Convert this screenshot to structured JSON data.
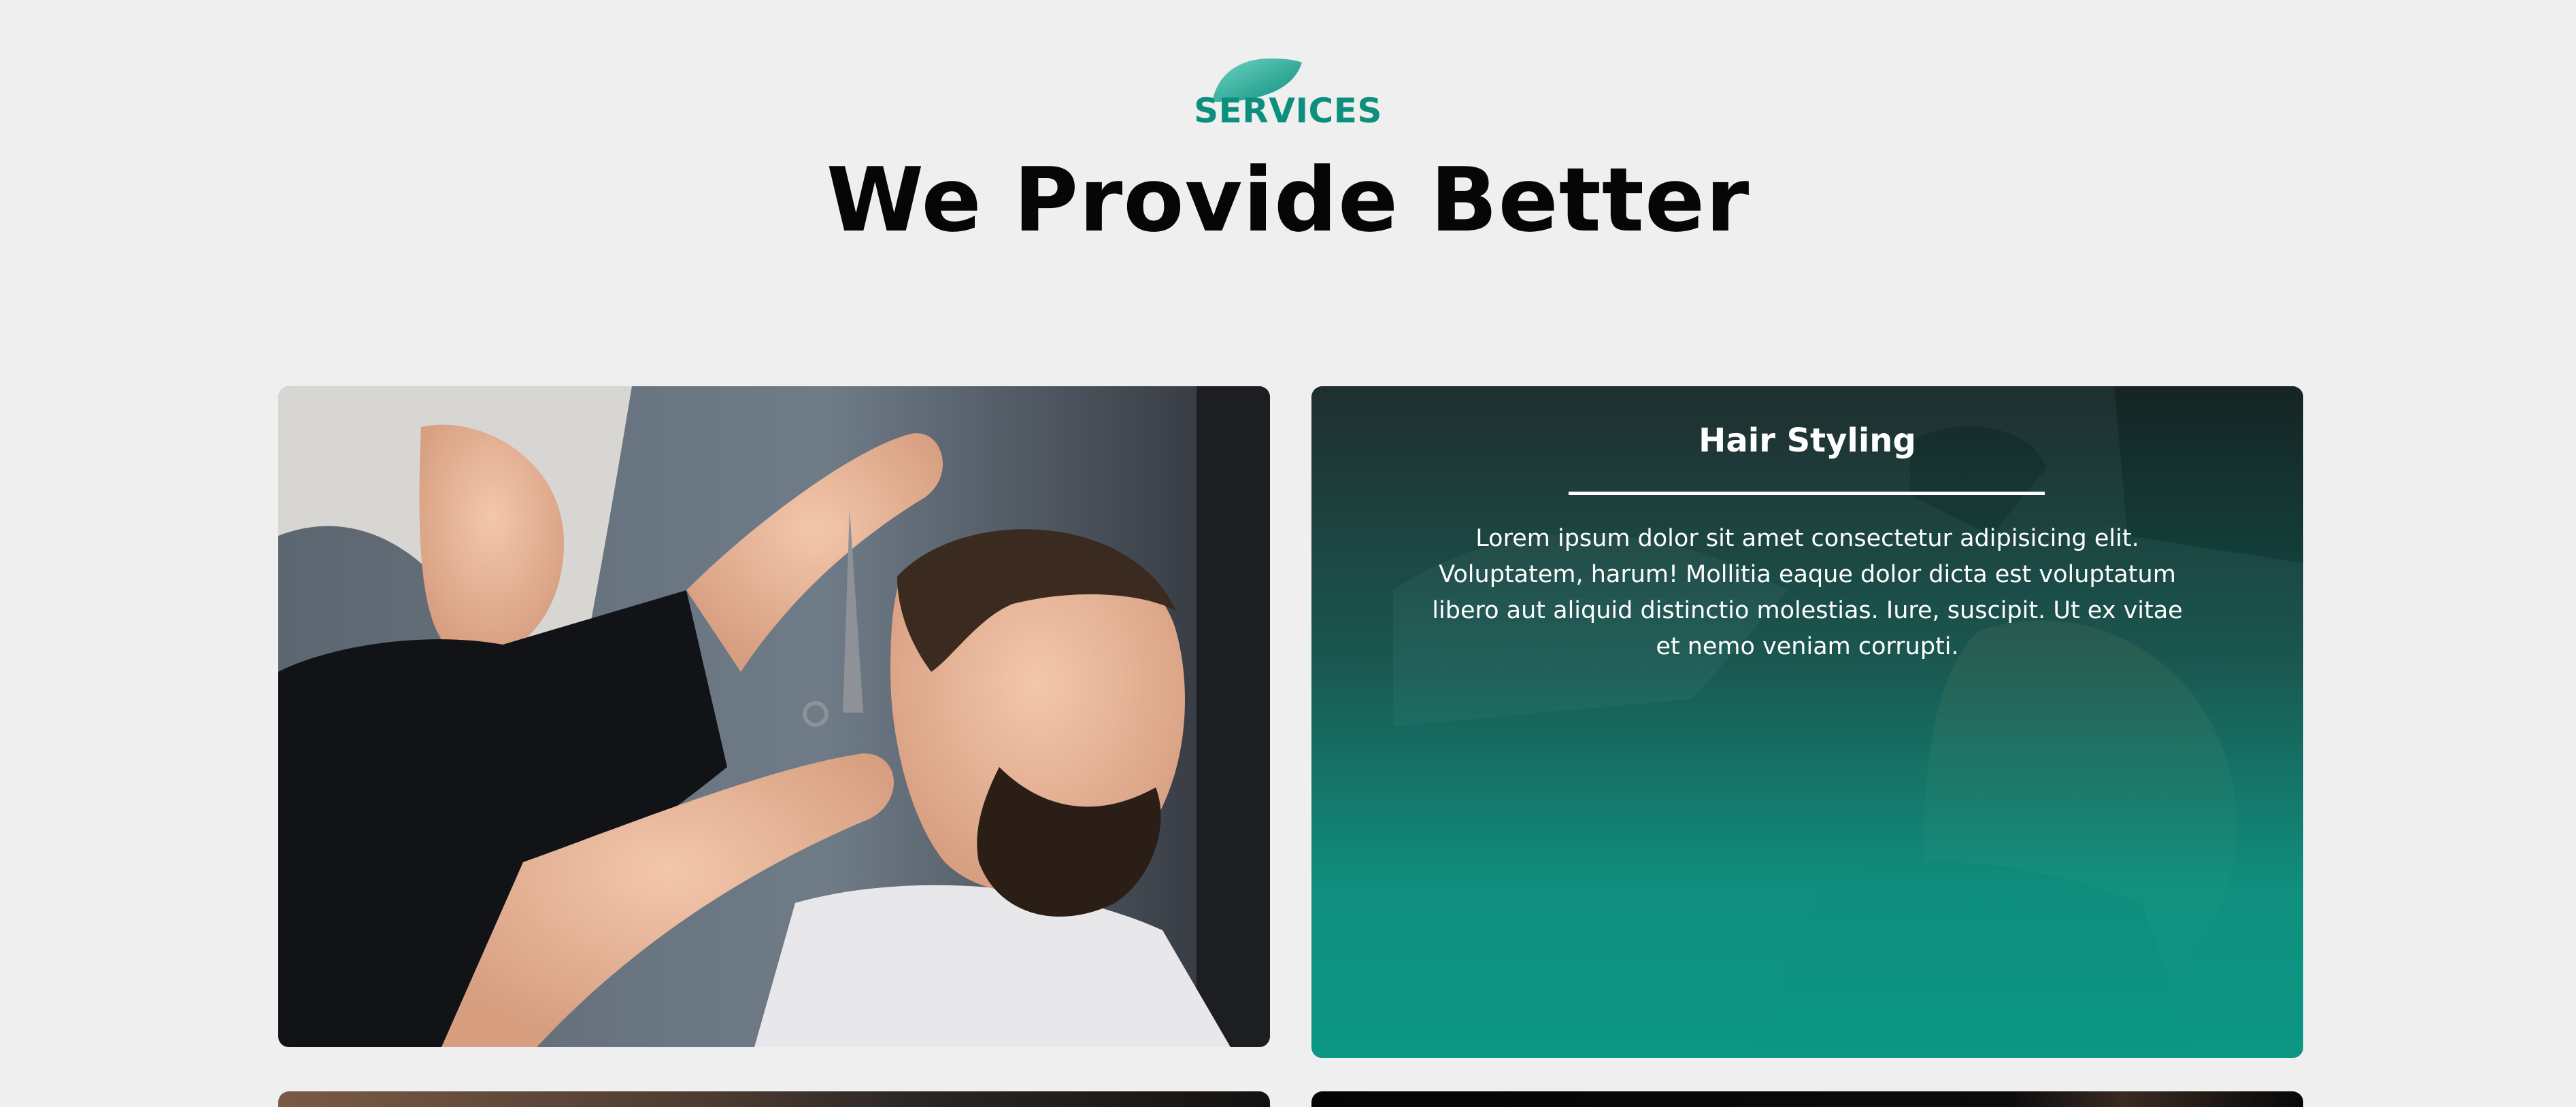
{
  "header": {
    "eyebrow": "SERVICES",
    "title": "We Provide Better",
    "icon": "leaf-icon"
  },
  "services": [
    {
      "image": "barber-cutting-hair-photo"
    },
    {
      "title": "Hair Styling",
      "description": "Lorem ipsum dolor sit amet consectetur adipisicing elit. Voluptatem, harum! Mollitia eaque dolor dicta est voluptatum libero aut aliquid distinctio molestias. Iure, suscipit. Ut ex vitae et nemo veniam corrupti.",
      "image": "beard-shaving-photo"
    }
  ],
  "colors": {
    "accent": "#0d8f7e",
    "background": "#efefef",
    "heading": "#060606"
  }
}
